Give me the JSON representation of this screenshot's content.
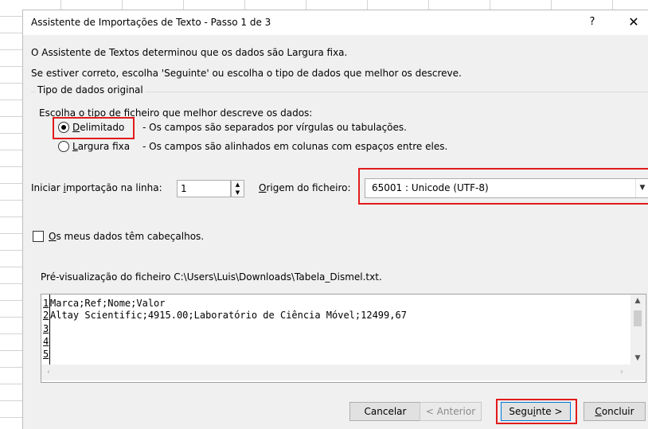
{
  "dialog": {
    "title": "Assistente de Importações de Texto - Passo 1 de 3",
    "help": "?",
    "close": "✕"
  },
  "intro": {
    "line1": "O Assistente de Textos determinou que os dados são Largura fixa.",
    "line2": "Se estiver correto, escolha 'Seguinte' ou escolha o tipo de dados que melhor os descreve."
  },
  "original_type": {
    "group_title": "Tipo de dados original",
    "prompt": "Escolha o tipo de ficheiro que melhor descreve os dados:",
    "options": [
      {
        "label_first": "D",
        "label_rest": "elimitado",
        "description": "- Os campos são separados por vírgulas ou tabulações.",
        "checked": true
      },
      {
        "label_first": "L",
        "label_rest": "argura fixa",
        "description": "- Os campos são alinhados em colunas com espaços entre eles.",
        "checked": false
      }
    ]
  },
  "start_row": {
    "label_pre": "Iniciar ",
    "label_mnemonic": "i",
    "label_post": "mportação na linha:",
    "value": "1"
  },
  "file_origin": {
    "label_mnemonic": "O",
    "label_rest": "rigem do ficheiro:",
    "value": "65001 : Unicode (UTF-8)"
  },
  "headers_checkbox": {
    "label_mnemonic": "O",
    "label_rest": "s meus dados têm cabeçalhos.",
    "checked": false
  },
  "preview": {
    "label": "Pré-visualização do ficheiro C:\\Users\\Luis\\Downloads\\Tabela_Dismel.txt.",
    "lines": [
      {
        "num": "1",
        "text": "Marca;Ref;Nome;Valor"
      },
      {
        "num": "2",
        "text": "Altay Scientific;4915.00;Laboratório de Ciência Móvel;12499,67"
      },
      {
        "num": "3",
        "text": ""
      },
      {
        "num": "4",
        "text": ""
      },
      {
        "num": "5",
        "text": ""
      }
    ]
  },
  "buttons": {
    "cancel": "Cancelar",
    "back": "< Anterior",
    "next_pre": "Segu",
    "next_mnemonic": "i",
    "next_post": "nte >",
    "finish_mnemonic": "C",
    "finish_rest": "oncluir"
  },
  "colors": {
    "highlight": "#e21b1b",
    "dialog_bg": "#f0f0f0",
    "primary_border": "#0078d7"
  }
}
